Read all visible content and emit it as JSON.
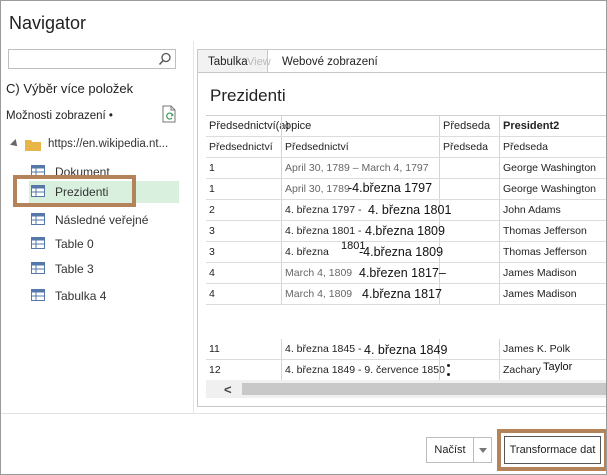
{
  "window": {
    "title": "Navigator"
  },
  "search": {
    "placeholder": ""
  },
  "left": {
    "select_multiple": "C) Výběr více položek",
    "display_options": "Možnosti zobrazení •",
    "root": "https://en.wikipedia.nt...",
    "items": [
      {
        "label": "Dokument"
      },
      {
        "label": "Prezidenti"
      },
      {
        "label": "Následné veřejné"
      },
      {
        "label": "Table 0"
      },
      {
        "label": "Table 3"
      },
      {
        "label": "Tabulka 4"
      }
    ]
  },
  "preview": {
    "tabs": {
      "table": "Tabulka",
      "ghost": "View",
      "web": "Webové zobrazení"
    },
    "title": "Prezidenti",
    "headers": [
      "Předsednictví(a)",
      "opice",
      "Předseda",
      "President2"
    ],
    "rows": [
      [
        "Předsednictví",
        "Předsednictví",
        "Předseda",
        "Předseda"
      ],
      [
        "1",
        "April 30, 1789 – March 4, 1797",
        "",
        "George Washington"
      ],
      [
        "1",
        "April 30, 1789",
        "",
        "George Washington"
      ],
      [
        "2",
        "4. března 1797 -",
        "",
        "John Adams"
      ],
      [
        "3",
        "4. března 1801 -",
        "",
        "Thomas Jefferson"
      ],
      [
        "3",
        "4. března",
        "",
        "Thomas Jefferson"
      ],
      [
        "4",
        "March 4, 1809",
        "",
        "James Madison"
      ],
      [
        "4",
        "March 4, 1809",
        "",
        "James Madison"
      ]
    ],
    "overlays": [
      "-4.března 1797",
      "4. března 1801",
      "4.března 1809",
      "1801",
      "-4.března 1809",
      "4.březen 1817–",
      "4.března 1817"
    ],
    "rows_bottom": [
      [
        "11",
        "4. března 1845 -",
        "",
        "James K. Polk"
      ],
      [
        "12",
        "4. března 1849 - 9. července 1850",
        "",
        "Zachary"
      ]
    ],
    "overlays_bottom": [
      "4. března 1849",
      "Taylor"
    ]
  },
  "footer": {
    "load": "Načíst",
    "transform": "Transformace dat"
  }
}
